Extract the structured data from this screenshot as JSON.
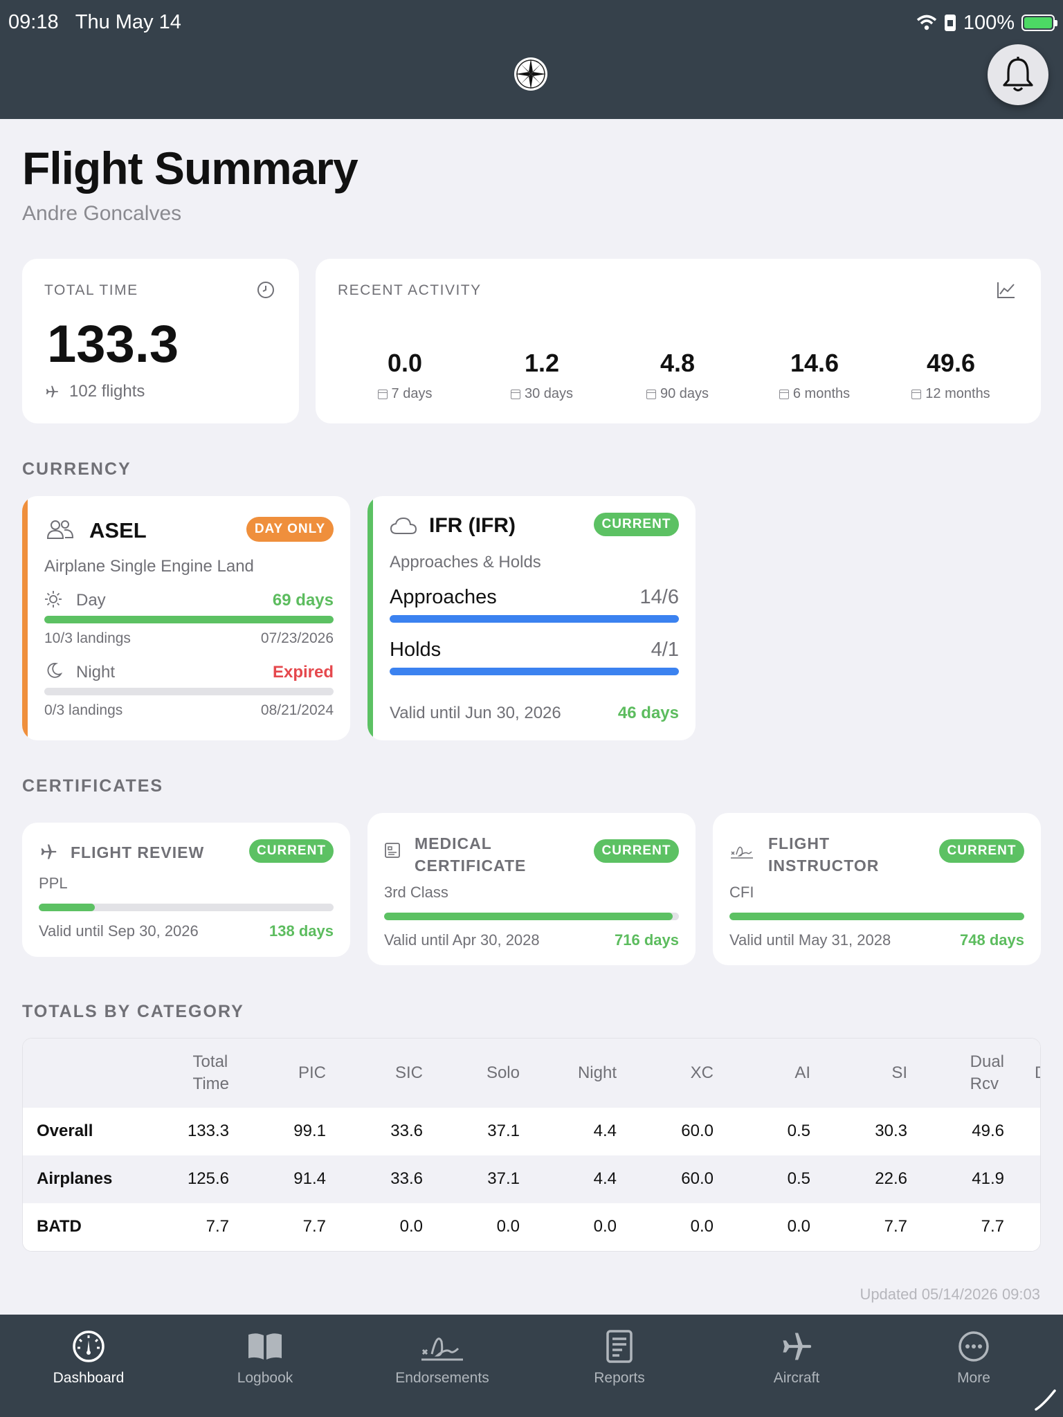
{
  "status": {
    "time": "09:18",
    "date": "Thu May 14",
    "battery": "100%"
  },
  "header": {
    "title": "Flight Summary",
    "subtitle": "Andre Goncalves"
  },
  "total_time": {
    "label": "TOTAL TIME",
    "value": "133.3",
    "flights": "102 flights"
  },
  "recent_activity": {
    "label": "RECENT ACTIVITY",
    "items": [
      {
        "value": "0.0",
        "period": "7 days"
      },
      {
        "value": "1.2",
        "period": "30 days"
      },
      {
        "value": "4.8",
        "period": "90 days"
      },
      {
        "value": "14.6",
        "period": "6 months"
      },
      {
        "value": "49.6",
        "period": "12 months"
      }
    ]
  },
  "sections": {
    "currency": "CURRENCY",
    "certificates": "CERTIFICATES",
    "totals": "TOTALS BY CATEGORY"
  },
  "asel": {
    "title": "ASEL",
    "badge": "DAY ONLY",
    "subtitle": "Airplane Single Engine Land",
    "day": {
      "label": "Day",
      "status": "69 days",
      "landings": "10/3 landings",
      "date": "07/23/2026",
      "progress": 1.0
    },
    "night": {
      "label": "Night",
      "status": "Expired",
      "landings": "0/3 landings",
      "date": "08/21/2024",
      "progress": 0.0
    },
    "accent": "#ef8f3c"
  },
  "ifr": {
    "title": "IFR (IFR)",
    "badge": "CURRENT",
    "subtitle": "Approaches & Holds",
    "approaches": {
      "label": "Approaches",
      "value": "14/6",
      "progress": 1.0
    },
    "holds": {
      "label": "Holds",
      "value": "4/1",
      "progress": 1.0
    },
    "valid": "Valid until Jun 30, 2026",
    "days": "46 days",
    "accent": "#5cc163"
  },
  "certificates": [
    {
      "title": "FLIGHT REVIEW",
      "badge": "CURRENT",
      "sub": "PPL",
      "valid": "Valid until Sep 30, 2026",
      "days": "138 days",
      "progress": 0.19
    },
    {
      "title1": "MEDICAL",
      "title2": "CERTIFICATE",
      "badge": "CURRENT",
      "sub": "3rd Class",
      "valid": "Valid until Apr 30, 2028",
      "days": "716 days",
      "progress": 0.98
    },
    {
      "title1": "FLIGHT",
      "title2": "INSTRUCTOR",
      "badge": "CURRENT",
      "sub": "CFI",
      "valid": "Valid until May 31, 2028",
      "days": "748 days",
      "progress": 1.0
    }
  ],
  "totals": {
    "headers": [
      "Total\nTime",
      "PIC",
      "SIC",
      "Solo",
      "Night",
      "XC",
      "AI",
      "SI",
      "Dual\nRcv",
      "D"
    ],
    "rows": [
      {
        "name": "Overall",
        "values": [
          "133.3",
          "99.1",
          "33.6",
          "37.1",
          "4.4",
          "60.0",
          "0.5",
          "30.3",
          "49.6"
        ]
      },
      {
        "name": "Airplanes",
        "values": [
          "125.6",
          "91.4",
          "33.6",
          "37.1",
          "4.4",
          "60.0",
          "0.5",
          "22.6",
          "41.9"
        ]
      },
      {
        "name": "BATD",
        "values": [
          "7.7",
          "7.7",
          "0.0",
          "0.0",
          "0.0",
          "0.0",
          "0.0",
          "7.7",
          "7.7"
        ]
      }
    ]
  },
  "updated": "Updated 05/14/2026 09:03",
  "tabs": [
    {
      "label": "Dashboard",
      "icon": "gauge-icon"
    },
    {
      "label": "Logbook",
      "icon": "book-icon"
    },
    {
      "label": "Endorsements",
      "icon": "signature-icon"
    },
    {
      "label": "Reports",
      "icon": "report-icon"
    },
    {
      "label": "Aircraft",
      "icon": "airplane-icon"
    },
    {
      "label": "More",
      "icon": "more-icon"
    }
  ],
  "colors": {
    "header": "#36414b",
    "green": "#5cc163",
    "orange": "#ef8f3c",
    "blue": "#3b82f0",
    "red": "#e5484d"
  }
}
